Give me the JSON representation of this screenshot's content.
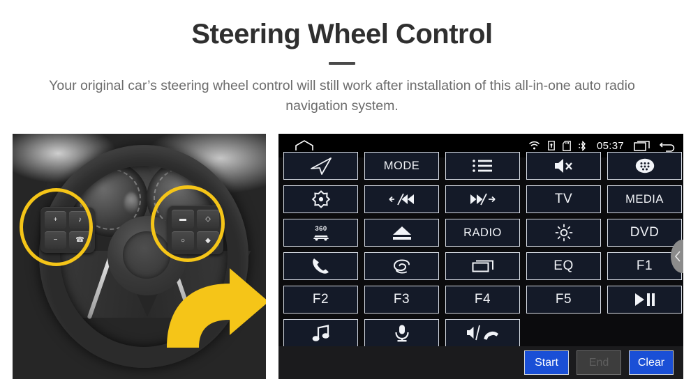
{
  "header": {
    "title": "Steering Wheel Control",
    "subtitle": "Your original car’s steering wheel control will still work after installation of this all-in-one auto radio navigation system."
  },
  "photo": {
    "alt": "Car steering wheel with two highlighted control pads and a yellow arrow",
    "highlight_color": "#f5c518",
    "left_pad_keys": [
      "+",
      "♪",
      "−",
      "☎"
    ],
    "right_pad_keys": [
      "▬",
      "◇",
      "○",
      "◆"
    ]
  },
  "radio": {
    "statusbar": {
      "home_icon": "home-icon",
      "icons": [
        "wifi-icon",
        "lock-icon",
        "sd-card-icon",
        "bluetooth-icon"
      ],
      "time": "05:37",
      "right_icons": [
        "recent-apps-icon",
        "back-icon"
      ]
    },
    "scroll_handle_icon": "chevron-left-icon",
    "buttons": [
      {
        "label": "",
        "icon": "navigation-arrow-icon",
        "name": "btn-navigation"
      },
      {
        "label": "MODE",
        "icon": "",
        "name": "btn-mode"
      },
      {
        "label": "",
        "icon": "list-icon",
        "name": "btn-list"
      },
      {
        "label": "",
        "icon": "mute-icon",
        "name": "btn-mute"
      },
      {
        "label": "",
        "icon": "apps-grid-icon",
        "name": "btn-apps"
      },
      {
        "label": "",
        "icon": "target-icon",
        "name": "btn-target"
      },
      {
        "label": "",
        "icon": "previous-track-icon",
        "name": "btn-previous"
      },
      {
        "label": "",
        "icon": "next-track-icon",
        "name": "btn-next"
      },
      {
        "label": "TV",
        "icon": "",
        "name": "btn-tv"
      },
      {
        "label": "MEDIA",
        "icon": "",
        "name": "btn-media"
      },
      {
        "label": "",
        "icon": "camera-360-icon",
        "name": "btn-360"
      },
      {
        "label": "",
        "icon": "eject-icon",
        "name": "btn-eject"
      },
      {
        "label": "RADIO",
        "icon": "",
        "name": "btn-radio"
      },
      {
        "label": "",
        "icon": "brightness-icon",
        "name": "btn-brightness"
      },
      {
        "label": "DVD",
        "icon": "",
        "name": "btn-dvd"
      },
      {
        "label": "",
        "icon": "phone-icon",
        "name": "btn-phone"
      },
      {
        "label": "",
        "icon": "swirl-icon",
        "name": "btn-swirl"
      },
      {
        "label": "",
        "icon": "window-icon",
        "name": "btn-window"
      },
      {
        "label": "EQ",
        "icon": "",
        "name": "btn-eq"
      },
      {
        "label": "F1",
        "icon": "",
        "name": "btn-f1"
      },
      {
        "label": "F2",
        "icon": "",
        "name": "btn-f2"
      },
      {
        "label": "F3",
        "icon": "",
        "name": "btn-f3"
      },
      {
        "label": "F4",
        "icon": "",
        "name": "btn-f4"
      },
      {
        "label": "F5",
        "icon": "",
        "name": "btn-f5"
      },
      {
        "label": "",
        "icon": "play-pause-icon",
        "name": "btn-play-pause"
      },
      {
        "label": "",
        "icon": "music-note-icon",
        "name": "btn-music"
      },
      {
        "label": "",
        "icon": "microphone-icon",
        "name": "btn-microphone"
      },
      {
        "label": "",
        "icon": "speaker-hangup-icon",
        "name": "btn-speaker-hangup"
      },
      {
        "label": "",
        "icon": "",
        "name": "btn-empty-1",
        "empty": true
      },
      {
        "label": "",
        "icon": "",
        "name": "btn-empty-2",
        "empty": true
      }
    ],
    "actions": [
      {
        "label": "Start",
        "name": "start-button",
        "disabled": false
      },
      {
        "label": "End",
        "name": "end-button",
        "disabled": true
      },
      {
        "label": "Clear",
        "name": "clear-button",
        "disabled": false
      }
    ],
    "colors": {
      "accent": "#1a4fd6",
      "button_fill": "#141a28",
      "button_border": "#d8dde6",
      "panel_bg": "#0b0b0d",
      "bottombar_bg": "#1b1b1d"
    }
  }
}
